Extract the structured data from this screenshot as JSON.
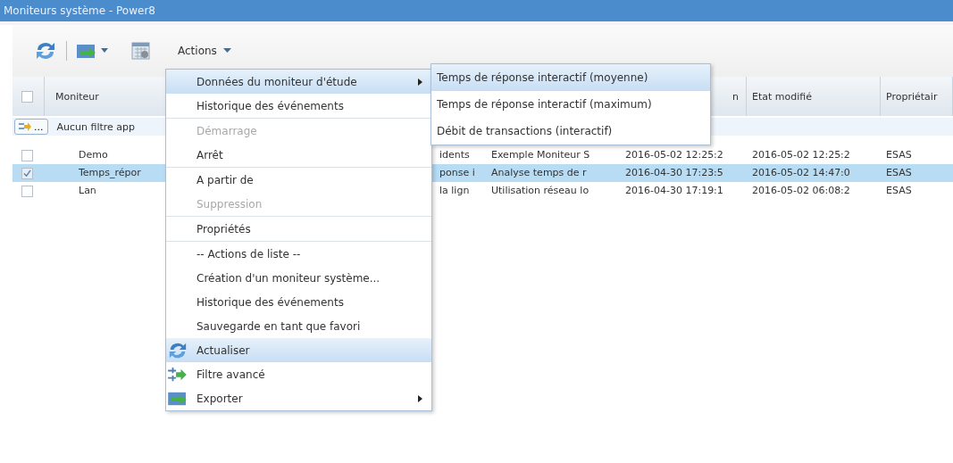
{
  "window": {
    "title": "Moniteurs système - Power8"
  },
  "toolbar": {
    "actions_label": "Actions"
  },
  "table": {
    "header_checked": false,
    "columns": [
      "Moniteur",
      "",
      "",
      "n",
      "Etat modifié",
      "Propriétair"
    ],
    "filter": {
      "button_label": "...",
      "text": "Aucun filtre app"
    },
    "rows": [
      {
        "checked": false,
        "selected": false,
        "cells": [
          "Demo",
          "idents",
          "Exemple Moniteur S",
          "2016-05-02 12:25:2",
          "2016-05-02 12:25:2",
          "ESAS"
        ]
      },
      {
        "checked": true,
        "selected": true,
        "cells": [
          "Temps_répor",
          "ponse i",
          "Analyse temps de r",
          "2016-04-30 17:23:5",
          "2016-05-02 14:47:0",
          "ESAS"
        ]
      },
      {
        "checked": false,
        "selected": false,
        "cells": [
          "Lan",
          "la lign",
          "Utilisation réseau lo",
          "2016-04-30 17:19:1",
          "2016-05-02 06:08:2",
          "ESAS"
        ]
      }
    ]
  },
  "menu": {
    "groups": [
      [
        {
          "kind": "plain",
          "label": "Données du moniteur d'étude",
          "disabled": false,
          "selected": true,
          "submenu": true
        },
        {
          "kind": "plain",
          "label": "Historique des événements",
          "disabled": false,
          "selected": false,
          "submenu": false
        }
      ],
      [
        {
          "kind": "plain",
          "label": "Démarrage",
          "disabled": true,
          "selected": false,
          "submenu": false
        },
        {
          "kind": "plain",
          "label": "Arrêt",
          "disabled": false,
          "selected": false,
          "submenu": false
        }
      ],
      [
        {
          "kind": "plain",
          "label": "A partir de",
          "disabled": false,
          "selected": false,
          "submenu": false
        },
        {
          "kind": "plain",
          "label": "Suppression",
          "disabled": true,
          "selected": false,
          "submenu": false
        }
      ],
      [
        {
          "kind": "plain",
          "label": "Propriétés",
          "disabled": false,
          "selected": false,
          "submenu": false
        }
      ],
      [
        {
          "kind": "plain",
          "label": "-- Actions de liste --",
          "disabled": false,
          "selected": false,
          "submenu": false
        },
        {
          "kind": "plain",
          "label": "Création d'un moniteur système...",
          "disabled": false,
          "selected": false,
          "submenu": false
        },
        {
          "kind": "plain",
          "label": "Historique des événements",
          "disabled": false,
          "selected": false,
          "submenu": false
        },
        {
          "kind": "plain",
          "label": "Sauvegarde en tant que favori",
          "disabled": false,
          "selected": false,
          "submenu": false
        },
        {
          "kind": "refresh",
          "label": "Actualiser",
          "disabled": false,
          "selected": true,
          "submenu": false
        },
        {
          "kind": "filter",
          "label": "Filtre avancé",
          "disabled": false,
          "selected": false,
          "submenu": false
        },
        {
          "kind": "export",
          "label": "Exporter",
          "disabled": false,
          "selected": false,
          "submenu": true
        }
      ]
    ]
  },
  "submenu": {
    "items": [
      {
        "label": "Temps de réponse interactif (moyenne)",
        "selected": true
      },
      {
        "label": "Temps de réponse interactif (maximum)",
        "selected": false
      },
      {
        "label": "Débit de transactions (interactif)",
        "selected": false
      }
    ]
  }
}
